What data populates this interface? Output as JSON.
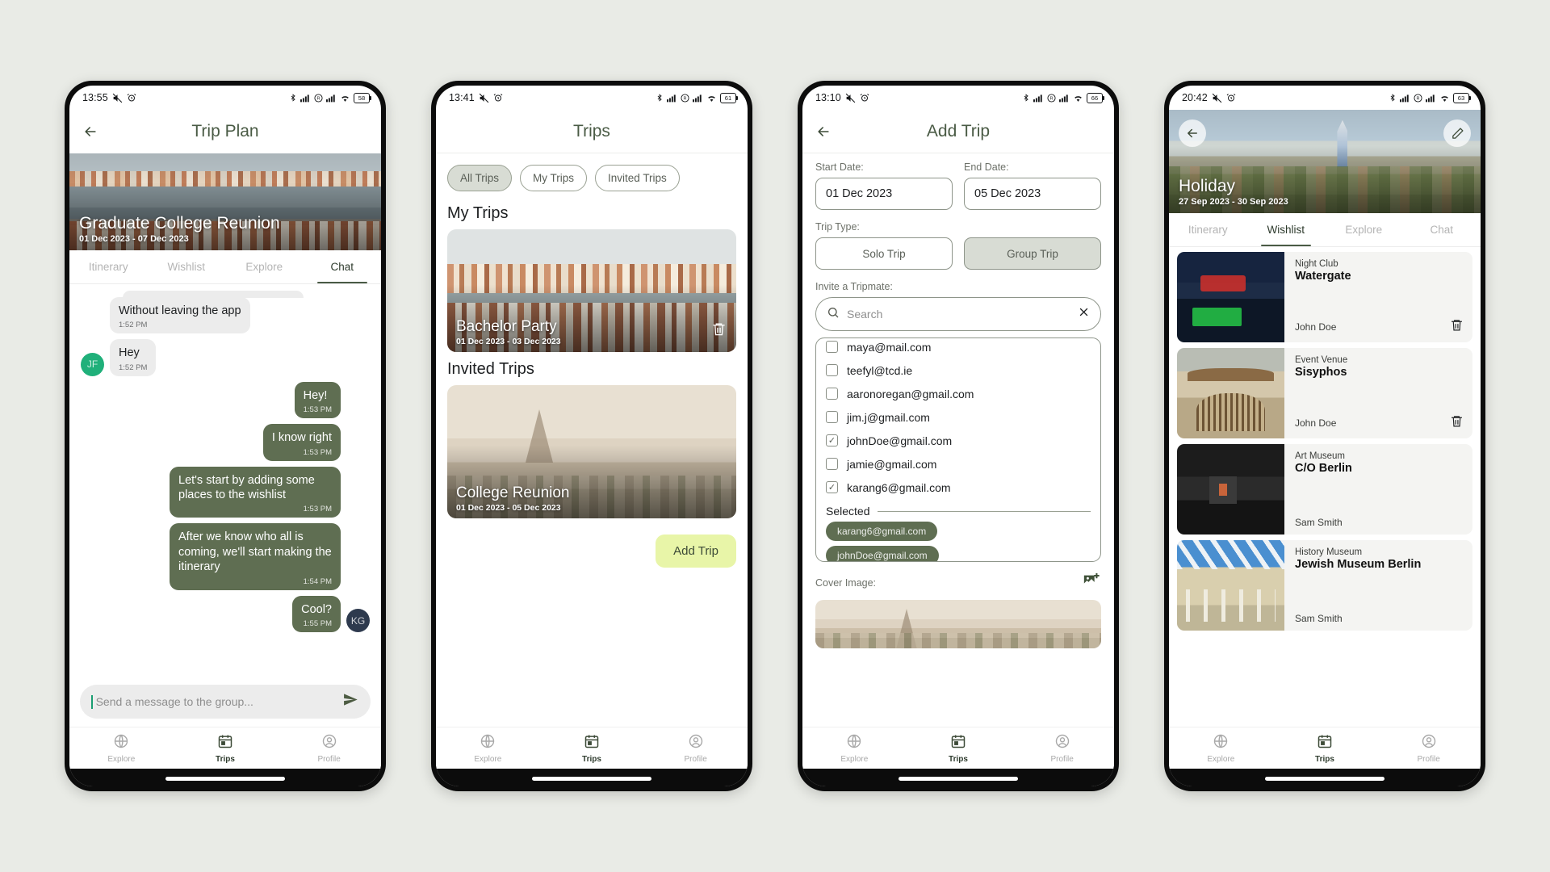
{
  "phone1": {
    "status": {
      "time": "13:55",
      "battery": "58",
      "icons": [
        "mute-icon",
        "alarm-icon",
        "bluetooth-icon",
        "signal-icon",
        "roaming-icon",
        "signal2-icon",
        "wifi-icon",
        "battery-icon"
      ]
    },
    "appbar": {
      "title": "Trip Plan",
      "back": "back-arrow-icon"
    },
    "hero": {
      "title": "Graduate College Reunion",
      "dates": "01 Dec 2023 - 07 Dec 2023"
    },
    "tabs": [
      {
        "label": "Itinerary",
        "active": false
      },
      {
        "label": "Wishlist",
        "active": false
      },
      {
        "label": "Explore",
        "active": false
      },
      {
        "label": "Chat",
        "active": true
      }
    ],
    "messages": [
      {
        "side": "them",
        "text": "Without leaving the app",
        "time": "1:52 PM",
        "avatar": ""
      },
      {
        "side": "them",
        "text": "Hey",
        "time": "1:52 PM",
        "avatar": "JF"
      },
      {
        "side": "me",
        "text": "Hey!",
        "time": "1:53 PM",
        "avatar": ""
      },
      {
        "side": "me",
        "text": "I know right",
        "time": "1:53 PM",
        "avatar": ""
      },
      {
        "side": "me",
        "text": "Let's start by adding some places to the wishlist",
        "time": "1:53 PM",
        "avatar": ""
      },
      {
        "side": "me",
        "text": "After we know who all is coming, we'll start making the itinerary",
        "time": "1:54 PM",
        "avatar": ""
      },
      {
        "side": "me",
        "text": "Cool?",
        "time": "1:55 PM",
        "avatar": "KG"
      }
    ],
    "input": {
      "placeholder": "Send a message to the group...",
      "send": "send-icon"
    },
    "nav": [
      {
        "label": "Explore",
        "icon": "globe-icon",
        "active": false
      },
      {
        "label": "Trips",
        "icon": "calendar-icon",
        "active": true
      },
      {
        "label": "Profile",
        "icon": "person-icon",
        "active": false
      }
    ]
  },
  "phone2": {
    "status": {
      "time": "13:41",
      "battery": "61"
    },
    "appbar": {
      "title": "Trips"
    },
    "chips": [
      {
        "label": "All Trips",
        "active": true
      },
      {
        "label": "My Trips",
        "active": false
      },
      {
        "label": "Invited Trips",
        "active": false
      }
    ],
    "sections": [
      {
        "title": "My Trips",
        "cards": [
          {
            "name": "Bachelor Party",
            "dates": "01 Dec 2023 - 03 Dec 2023",
            "photo": "venice2",
            "delete": "trash-icon"
          }
        ]
      },
      {
        "title": "Invited Trips",
        "cards": [
          {
            "name": "College Reunion",
            "dates": "01 Dec 2023 - 05 Dec 2023",
            "photo": "paris",
            "delete": ""
          }
        ]
      }
    ],
    "add_trip_label": "Add Trip",
    "nav": [
      {
        "label": "Explore",
        "icon": "globe-icon",
        "active": false
      },
      {
        "label": "Trips",
        "icon": "calendar-icon",
        "active": true
      },
      {
        "label": "Profile",
        "icon": "person-icon",
        "active": false
      }
    ]
  },
  "phone3": {
    "status": {
      "time": "13:10",
      "battery": "66"
    },
    "appbar": {
      "title": "Add Trip",
      "back": "back-arrow-icon"
    },
    "start_date": {
      "label": "Start Date:",
      "value": "01 Dec 2023"
    },
    "end_date": {
      "label": "End Date:",
      "value": "05 Dec 2023"
    },
    "trip_type": {
      "label": "Trip Type:",
      "options": [
        {
          "label": "Solo Trip",
          "active": false
        },
        {
          "label": "Group Trip",
          "active": true
        }
      ]
    },
    "invite": {
      "label": "Invite a Tripmate:",
      "search_placeholder": "Search",
      "search_icon": "search-icon",
      "clear_icon": "close-icon",
      "options": [
        {
          "email": "maya@mail.com",
          "checked": false
        },
        {
          "email": "teefyl@tcd.ie",
          "checked": false
        },
        {
          "email": "aaronoregan@gmail.com",
          "checked": false
        },
        {
          "email": "jim.j@gmail.com",
          "checked": false
        },
        {
          "email": "johnDoe@gmail.com",
          "checked": true
        },
        {
          "email": "jamie@gmail.com",
          "checked": false
        },
        {
          "email": "karang6@gmail.com",
          "checked": true
        }
      ],
      "selected_label": "Selected",
      "selected": [
        "karang6@gmail.com",
        "johnDoe@gmail.com"
      ]
    },
    "cover": {
      "label": "Cover Image:",
      "icon": "add-image-icon"
    },
    "nav": [
      {
        "label": "Explore",
        "icon": "globe-icon",
        "active": false
      },
      {
        "label": "Trips",
        "icon": "calendar-icon",
        "active": true
      },
      {
        "label": "Profile",
        "icon": "person-icon",
        "active": false
      }
    ]
  },
  "phone4": {
    "status": {
      "time": "20:42",
      "battery": "63"
    },
    "hero": {
      "title": "Holiday",
      "dates": "27 Sep 2023 - 30 Sep 2023",
      "back": "back-arrow-icon",
      "edit": "pencil-icon"
    },
    "tabs": [
      {
        "label": "Itinerary",
        "active": false
      },
      {
        "label": "Wishlist",
        "active": true
      },
      {
        "label": "Explore",
        "active": false
      },
      {
        "label": "Chat",
        "active": false
      }
    ],
    "wishlist": [
      {
        "category": "Night Club",
        "name": "Watergate",
        "user": "John Doe",
        "photo": "club",
        "delete": "trash-icon"
      },
      {
        "category": "Event Venue",
        "name": "Sisyphos",
        "user": "John Doe",
        "photo": "gate",
        "delete": "trash-icon"
      },
      {
        "category": "Art Museum",
        "name": "C/O Berlin",
        "user": "Sam Smith",
        "photo": "art",
        "delete": ""
      },
      {
        "category": "History Museum",
        "name": "Jewish Museum Berlin",
        "user": "Sam Smith",
        "photo": "jewish",
        "delete": ""
      }
    ],
    "nav": [
      {
        "label": "Explore",
        "icon": "globe-icon",
        "active": false
      },
      {
        "label": "Trips",
        "icon": "calendar-icon",
        "active": true
      },
      {
        "label": "Profile",
        "icon": "person-icon",
        "active": false
      }
    ]
  },
  "colors": {
    "accent": "#5f6e52",
    "header": "#4a5b45",
    "cta": "#e8f5a8",
    "chip_active": "#d8dcd4"
  }
}
